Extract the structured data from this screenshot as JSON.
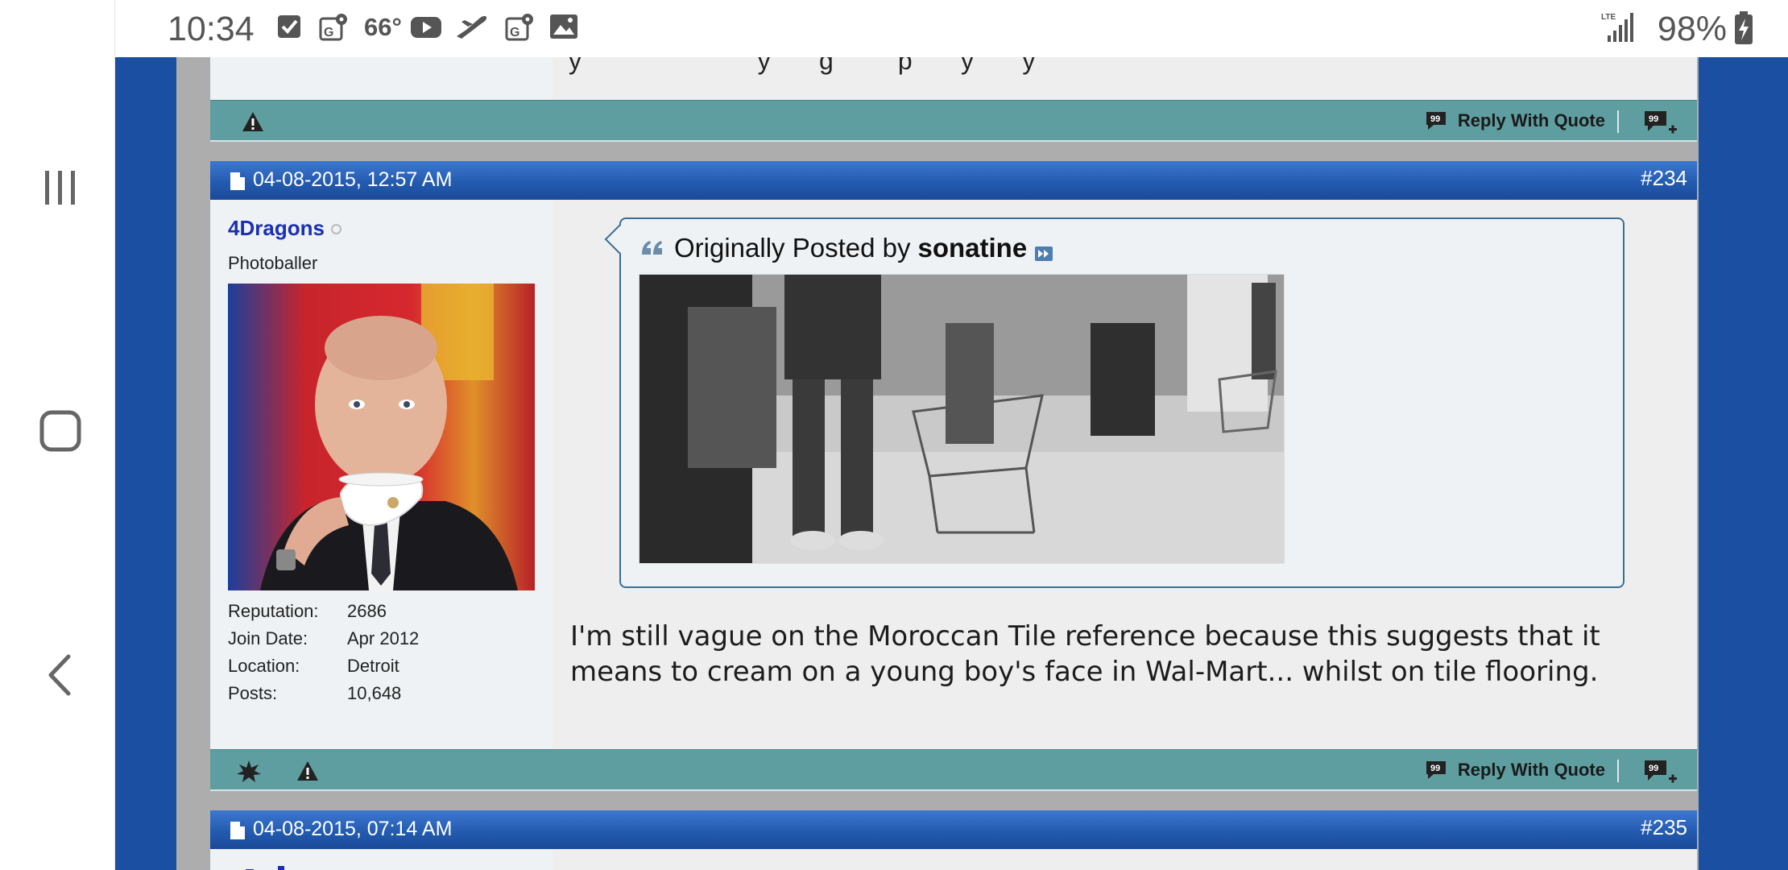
{
  "status_bar": {
    "time": "10:34",
    "temperature": "66°",
    "battery": "98%",
    "network": "LTE",
    "icons": [
      "checkbox-icon",
      "maps-icon",
      "youtube-icon",
      "flight-icon",
      "maps-icon",
      "gallery-icon",
      "signal-icon",
      "battery-charging-icon"
    ]
  },
  "nav_bar": {
    "items": [
      "recents-icon",
      "home-icon",
      "back-icon"
    ]
  },
  "previous_post": {
    "footer": {
      "reply_with_quote": "Reply With Quote"
    }
  },
  "post": {
    "date": "04-08-2015, 12:57 AM",
    "number": "#234",
    "user": {
      "username": "4Dragons",
      "title": "Photoballer",
      "stats": [
        {
          "label": "Reputation:",
          "value": "2686"
        },
        {
          "label": "Join Date:",
          "value": "Apr 2012"
        },
        {
          "label": "Location:",
          "value": "Detroit"
        },
        {
          "label": "Posts:",
          "value": "10,648"
        }
      ]
    },
    "quote": {
      "prefix": "Originally Posted by",
      "author": "sonatine"
    },
    "message": "I'm still vague on the Moroccan Tile reference because this suggests that it means to cream on a young boy's face in Wal-Mart... whilst on tile flooring.",
    "footer": {
      "reply_with_quote": "Reply With Quote"
    }
  },
  "next_post": {
    "date": "04-08-2015, 07:14 AM",
    "number": "#235"
  },
  "colors": {
    "header_blue": "#235bb0",
    "footer_teal": "#5f9ea0",
    "page_blue": "#1a4fa1",
    "username_blue": "#1b2fb5"
  }
}
